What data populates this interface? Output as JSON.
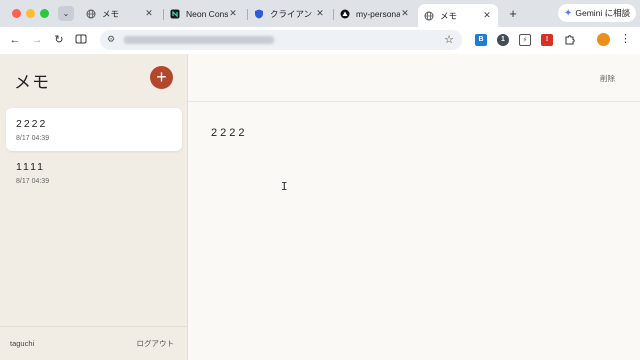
{
  "browser": {
    "tabs": [
      {
        "title": "メモ",
        "active": false,
        "icon": "globe-icon"
      },
      {
        "title": "Neon Console",
        "active": false,
        "icon": "neon-icon"
      },
      {
        "title": "クライアント",
        "active": false,
        "icon": "shield-icon"
      },
      {
        "title": "my-personal",
        "active": false,
        "icon": "vercel-icon"
      },
      {
        "title": "メモ",
        "active": true,
        "icon": "globe-icon"
      }
    ],
    "new_tab": "+",
    "gemini_label": "Gemini に相談",
    "extensions": [
      {
        "label": "B",
        "color": "#1f7bd8"
      },
      {
        "label": "1",
        "color": "#444b57"
      },
      {
        "label": "⚡",
        "color": "#555555"
      },
      {
        "label": "!",
        "color": "#d93025"
      }
    ],
    "profile_color": "#e8901a"
  },
  "app": {
    "title": "メモ",
    "add_label": "+",
    "notes": [
      {
        "title": "2222",
        "date": "8/17 04:39",
        "selected": true
      },
      {
        "title": "1111",
        "date": "8/17 04:39",
        "selected": false
      }
    ],
    "user": "taguchi",
    "logout_label": "ログアウト",
    "delete_label": "削除",
    "editor_text": "2222",
    "accent_color": "#b3472c"
  }
}
